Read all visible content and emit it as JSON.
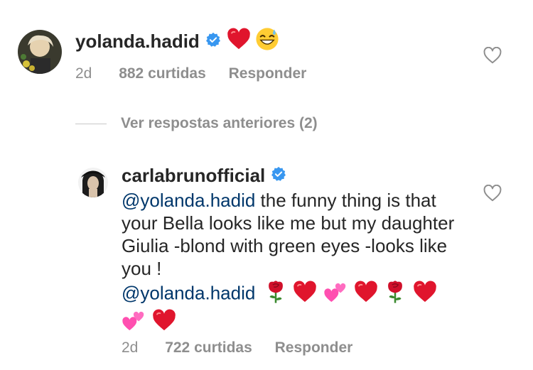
{
  "comment1": {
    "username": "yolanda.hadid",
    "time": "2d",
    "likes": "882 curtidas",
    "reply_label": "Responder",
    "emojis": [
      "red-heart",
      "grinning-sweat"
    ]
  },
  "view_replies": {
    "label": "Ver respostas anteriores (2)"
  },
  "comment2": {
    "username": "carlabrunofficial",
    "mention": "@yolanda.hadid",
    "text": "the funny thing is that your Bella looks like me but my daughter Giulia -blond with green eyes -looks like you !",
    "mention2": "@yolanda.hadid",
    "emojis": [
      "rose",
      "red-heart",
      "two-hearts",
      "red-heart",
      "rose",
      "red-heart",
      "two-hearts",
      "red-heart"
    ],
    "time": "2d",
    "likes": "722 curtidas",
    "reply_label": "Responder"
  },
  "colors": {
    "verified": "#3897f0",
    "meta": "#8e8e8e",
    "mention": "#00376b",
    "heart": "#e0152d"
  }
}
